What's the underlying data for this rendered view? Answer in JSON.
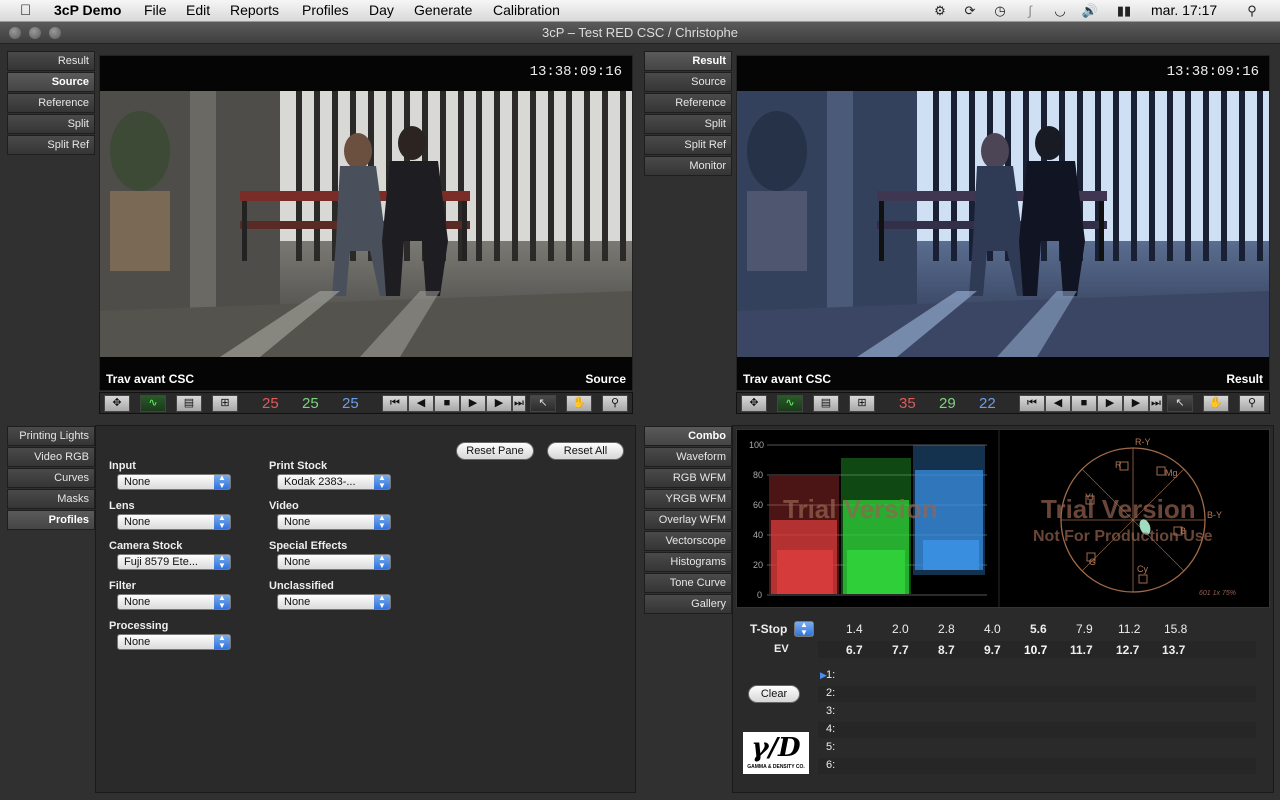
{
  "menubar": {
    "app_name": "3cP Demo",
    "menus": [
      "File",
      "Edit",
      "Reports",
      "Profiles",
      "Day",
      "Generate",
      "Calibration"
    ],
    "clock": "mar. 17:17"
  },
  "window": {
    "title": "3cP – Test RED CSC / Christophe"
  },
  "left_view_buttons": [
    "Result",
    "Source",
    "Reference",
    "Split",
    "Split Ref"
  ],
  "right_view_buttons": [
    "Result",
    "Source",
    "Reference",
    "Split",
    "Split Ref",
    "Monitor"
  ],
  "left_viewer": {
    "timecode": "13:38:09:16",
    "clip_name": "Trav avant CSC",
    "view_name": "Source",
    "r": "25",
    "g": "25",
    "b": "25"
  },
  "right_viewer": {
    "timecode": "13:38:09:16",
    "clip_name": "Trav avant CSC",
    "view_name": "Result",
    "r": "35",
    "g": "29",
    "b": "22"
  },
  "colors": {
    "r": "#e05a5a",
    "g": "#7ed37e",
    "b": "#6f9ee8",
    "accent": "#2d6fd9"
  },
  "left_tabs": [
    "Printing Lights",
    "Video RGB",
    "Curves",
    "Masks",
    "Profiles"
  ],
  "profiles_pane": {
    "reset_pane": "Reset Pane",
    "reset_all": "Reset All",
    "input": {
      "label": "Input",
      "value": "None"
    },
    "lens": {
      "label": "Lens",
      "value": "None"
    },
    "camera_stock": {
      "label": "Camera Stock",
      "value": "Fuji 8579 Ete..."
    },
    "filter": {
      "label": "Filter",
      "value": "None"
    },
    "processing": {
      "label": "Processing",
      "value": "None"
    },
    "print_stock": {
      "label": "Print Stock",
      "value": "Kodak 2383-..."
    },
    "video": {
      "label": "Video",
      "value": "None"
    },
    "special_effects": {
      "label": "Special Effects",
      "value": "None"
    },
    "unclassified": {
      "label": "Unclassified",
      "value": "None"
    }
  },
  "scope_tabs": [
    "Combo",
    "Waveform",
    "RGB WFM",
    "YRGB WFM",
    "Overlay WFM",
    "Vectorscope",
    "Histograms",
    "Tone Curve",
    "Gallery"
  ],
  "waveform": {
    "ticks": [
      "100",
      "80",
      "60",
      "40",
      "20",
      "0"
    ]
  },
  "vectorscope": {
    "labels": [
      "R-Y",
      "Mg",
      "R",
      "YI",
      "B-Y",
      "B",
      "G",
      "Cy"
    ],
    "footer": "601 1x 75%"
  },
  "watermark": {
    "line1": "Trial Version",
    "line2": "Not For Production Use"
  },
  "exposure": {
    "tstop_label": "T-Stop",
    "ev_label": "EV",
    "tstops": [
      "1.4",
      "2.0",
      "2.8",
      "4.0",
      "5.6",
      "7.9",
      "11.2",
      "15.8"
    ],
    "ev": [
      "6.7",
      "7.7",
      "8.7",
      "9.7",
      "10.7",
      "11.7",
      "12.7",
      "13.7"
    ]
  },
  "history": {
    "clear_label": "Clear",
    "rows": [
      "1:",
      "2:",
      "3:",
      "4:",
      "5:",
      "6:"
    ]
  },
  "logo": {
    "text": "γ/D",
    "caption": "GAMMA & DENSITY CO."
  }
}
